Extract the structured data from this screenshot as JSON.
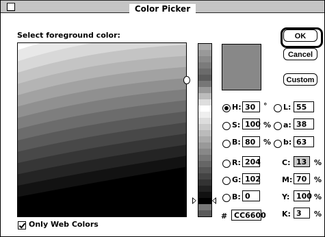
{
  "window": {
    "title": "Color Picker"
  },
  "prompt": "Select foreground color:",
  "buttons": {
    "ok": "OK",
    "cancel": "Cancel",
    "custom": "Custom"
  },
  "colors": {
    "current": "#888888",
    "field_bands": [
      "#ffffff",
      "#e8e8e8",
      "#d8d8d8",
      "#c4c4c4",
      "#b4b4b4",
      "#a2a2a2",
      "#909090",
      "#7e7e7e",
      "#6c6c6c",
      "#5a5a5a",
      "#484848",
      "#363636",
      "#242424",
      "#121212",
      "#000000"
    ],
    "slider_bands": [
      "#a9a9a9",
      "#999999",
      "#8a8a8a",
      "#7b7b7b",
      "#6b6b6b",
      "#5c5c5c",
      "#777777",
      "#9a9a9a",
      "#bcbcbc",
      "#dedede",
      "#ffffff",
      "#efefef",
      "#dddddd",
      "#cccccc",
      "#bbbbbb",
      "#aaaaaa",
      "#999999",
      "#888888",
      "#777777",
      "#666666",
      "#555555",
      "#444444",
      "#333333",
      "#222222",
      "#111111",
      "#000000",
      "#777777",
      "#5a5a5a"
    ]
  },
  "hsb": {
    "h": {
      "label": "H:",
      "value": "30",
      "unit": "°",
      "selected": true
    },
    "s": {
      "label": "S:",
      "value": "100",
      "unit": "%"
    },
    "b": {
      "label": "B:",
      "value": "80",
      "unit": "%"
    }
  },
  "lab": {
    "l": {
      "label": "L:",
      "value": "55"
    },
    "a": {
      "label": "a:",
      "value": "38"
    },
    "b": {
      "label": "b:",
      "value": "63"
    }
  },
  "rgb": {
    "r": {
      "label": "R:",
      "value": "204"
    },
    "g": {
      "label": "G:",
      "value": "102"
    },
    "b": {
      "label": "B:",
      "value": "0"
    }
  },
  "cmyk": {
    "c": {
      "label": "C:",
      "value": "13",
      "unit": "%"
    },
    "m": {
      "label": "M:",
      "value": "70",
      "unit": "%"
    },
    "y": {
      "label": "Y:",
      "value": "100",
      "unit": "%"
    },
    "k": {
      "label": "K:",
      "value": "3",
      "unit": "%"
    }
  },
  "hex": {
    "label": "#",
    "value": "CC6600"
  },
  "web_only": {
    "label": "Only Web Colors",
    "checked": true
  }
}
